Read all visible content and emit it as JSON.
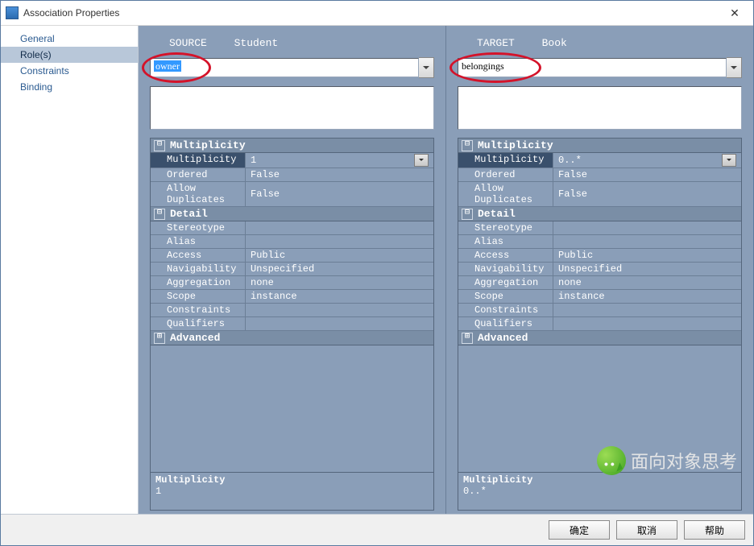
{
  "window": {
    "title": "Association Properties",
    "close": "✕"
  },
  "sidebar": {
    "items": [
      {
        "label": "General"
      },
      {
        "label": "Role(s)"
      },
      {
        "label": "Constraints"
      },
      {
        "label": "Binding"
      }
    ],
    "selectedIndex": 1
  },
  "source": {
    "heading1": "SOURCE",
    "heading2": "Student",
    "role": "owner",
    "roleSelected": true,
    "groups": {
      "multiplicity": {
        "title": "Multiplicity",
        "rows": [
          {
            "name": "Multiplicity",
            "value": "1",
            "dd": true,
            "sel": true
          },
          {
            "name": "Ordered",
            "value": "False"
          },
          {
            "name": "Allow Duplicates",
            "value": "False"
          }
        ]
      },
      "detail": {
        "title": "Detail",
        "rows": [
          {
            "name": "Stereotype",
            "value": ""
          },
          {
            "name": "Alias",
            "value": ""
          },
          {
            "name": "Access",
            "value": "Public"
          },
          {
            "name": "Navigability",
            "value": "Unspecified"
          },
          {
            "name": "Aggregation",
            "value": "none"
          },
          {
            "name": "Scope",
            "value": "instance"
          },
          {
            "name": "Constraints",
            "value": ""
          },
          {
            "name": "Qualifiers",
            "value": ""
          }
        ]
      },
      "advanced": {
        "title": "Advanced"
      }
    },
    "desc": {
      "title": "Multiplicity",
      "text": "1"
    }
  },
  "target": {
    "heading1": "TARGET",
    "heading2": "Book",
    "role": "belongings",
    "roleSelected": false,
    "groups": {
      "multiplicity": {
        "title": "Multiplicity",
        "rows": [
          {
            "name": "Multiplicity",
            "value": "0..*",
            "dd": true,
            "sel": true
          },
          {
            "name": "Ordered",
            "value": "False"
          },
          {
            "name": "Allow Duplicates",
            "value": "False"
          }
        ]
      },
      "detail": {
        "title": "Detail",
        "rows": [
          {
            "name": "Stereotype",
            "value": ""
          },
          {
            "name": "Alias",
            "value": ""
          },
          {
            "name": "Access",
            "value": "Public"
          },
          {
            "name": "Navigability",
            "value": "Unspecified"
          },
          {
            "name": "Aggregation",
            "value": "none"
          },
          {
            "name": "Scope",
            "value": "instance"
          },
          {
            "name": "Constraints",
            "value": ""
          },
          {
            "name": "Qualifiers",
            "value": ""
          }
        ]
      },
      "advanced": {
        "title": "Advanced"
      }
    },
    "desc": {
      "title": "Multiplicity",
      "text": "0..*"
    }
  },
  "expanders": {
    "minus": "⊟",
    "plus": "⊞"
  },
  "footer": {
    "ok": "确定",
    "cancel": "取消",
    "help": "帮助"
  },
  "watermark": {
    "text": "面向对象思考"
  }
}
